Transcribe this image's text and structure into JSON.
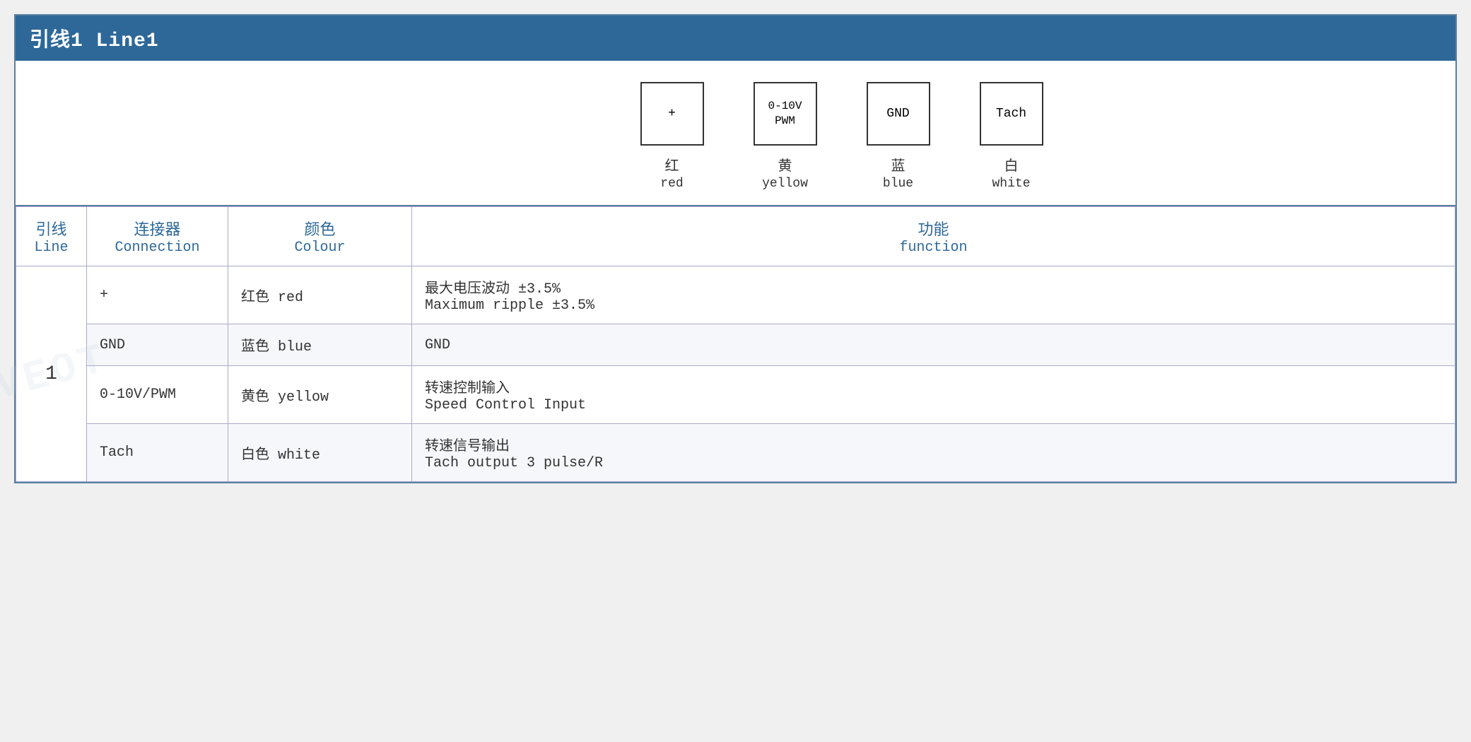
{
  "header": {
    "title": "引线1 Line1"
  },
  "diagram": {
    "connectors": [
      {
        "id": "conn-plus",
        "symbol": "+",
        "label_cn": "红",
        "label_en": "red"
      },
      {
        "id": "conn-pwm",
        "symbol": "0-10V\nPWM",
        "label_cn": "黄",
        "label_en": "yellow"
      },
      {
        "id": "conn-gnd",
        "symbol": "GND",
        "label_cn": "蓝",
        "label_en": "blue"
      },
      {
        "id": "conn-tach",
        "symbol": "Tach",
        "label_cn": "白",
        "label_en": "white"
      }
    ]
  },
  "table": {
    "headers": {
      "line_cn": "引线",
      "line_en": "Line",
      "conn_cn": "连接器",
      "conn_en": "Connection",
      "color_cn": "颜色",
      "color_en": "Colour",
      "func_cn": "功能",
      "func_en": "function"
    },
    "rows": [
      {
        "line": "1",
        "connection": "+",
        "color_cn": "红色 red",
        "func_cn": "最大电压波动 ±3.5%",
        "func_en": "Maximum ripple ±3.5%"
      },
      {
        "line": "",
        "connection": "GND",
        "color_cn": "蓝色 blue",
        "func_cn": "GND",
        "func_en": ""
      },
      {
        "line": "",
        "connection": "0-10V/PWM",
        "color_cn": "黄色 yellow",
        "func_cn": "转速控制输入",
        "func_en": "Speed Control Input"
      },
      {
        "line": "",
        "connection": "Tach",
        "color_cn": "白色 white",
        "func_cn": "转速信号输出",
        "func_en": "Tach output 3 pulse/R"
      }
    ]
  }
}
